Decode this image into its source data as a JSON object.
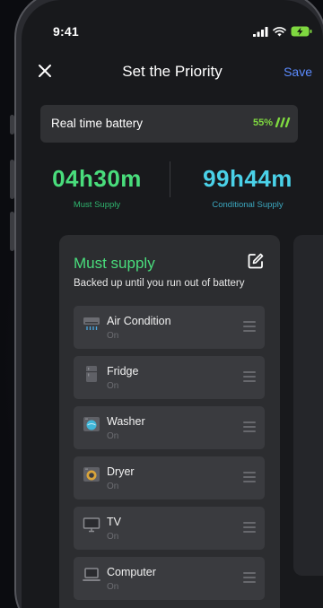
{
  "status_bar": {
    "time": "9:41"
  },
  "nav": {
    "title": "Set the Priority",
    "save_label": "Save",
    "close_icon": "close-icon"
  },
  "battery": {
    "label": "Real time battery",
    "value": "55%"
  },
  "supply_times": {
    "must": {
      "value": "04h30m",
      "label": "Must Supply"
    },
    "conditional": {
      "value": "99h44m",
      "label": "Conditional Supply"
    }
  },
  "must_card": {
    "title": "Must supply",
    "subtitle": "Backed up until you run out of battery",
    "items": [
      {
        "name": "Air Condition",
        "status": "On",
        "icon": "air-conditioner-icon"
      },
      {
        "name": "Fridge",
        "status": "On",
        "icon": "fridge-icon"
      },
      {
        "name": "Washer",
        "status": "On",
        "icon": "washer-icon"
      },
      {
        "name": "Dryer",
        "status": "On",
        "icon": "dryer-icon"
      },
      {
        "name": "TV",
        "status": "On",
        "icon": "tv-icon"
      },
      {
        "name": "Computer",
        "status": "On",
        "icon": "computer-icon"
      }
    ]
  },
  "colors": {
    "accent_green": "#49dd7c",
    "accent_blue": "#4ad1e8",
    "save_blue": "#5b8bff",
    "battery_green": "#7fd840"
  }
}
